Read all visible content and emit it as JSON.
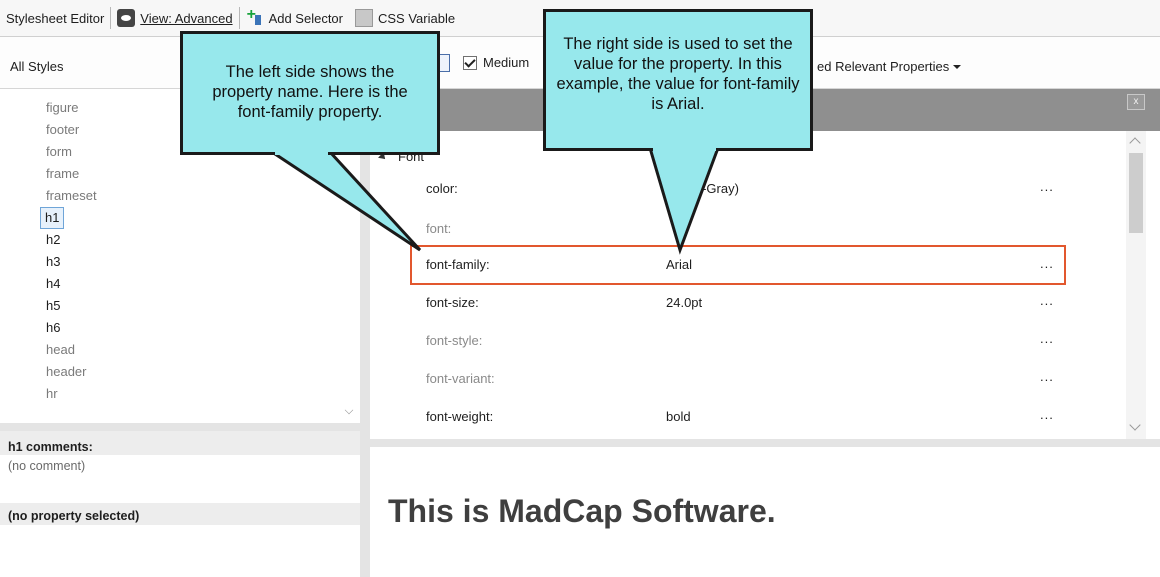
{
  "toolbar": {
    "title": "Stylesheet Editor",
    "view_label": "View: Advanced",
    "add_selector_label": "Add Selector",
    "css_variable_label": "CSS Variable"
  },
  "filterbar": {
    "all_styles_label": "All Styles",
    "medium_label": "Medium",
    "relevant_label": "ed Relevant Properties"
  },
  "selectors": [
    {
      "label": "figure",
      "state": "normal"
    },
    {
      "label": "footer",
      "state": "normal"
    },
    {
      "label": "form",
      "state": "normal"
    },
    {
      "label": "frame",
      "state": "normal"
    },
    {
      "label": "frameset",
      "state": "normal"
    },
    {
      "label": "h1",
      "state": "selected"
    },
    {
      "label": "h2",
      "state": "strong"
    },
    {
      "label": "h3",
      "state": "strong"
    },
    {
      "label": "h4",
      "state": "strong"
    },
    {
      "label": "h5",
      "state": "strong"
    },
    {
      "label": "h6",
      "state": "strong"
    },
    {
      "label": "head",
      "state": "normal"
    },
    {
      "label": "header",
      "state": "normal"
    },
    {
      "label": "hr",
      "state": "normal"
    }
  ],
  "comments": {
    "heading": "h1 comments:",
    "body": "(no comment)"
  },
  "property_panel": {
    "no_selection": "(no property selected)",
    "close_label": "x",
    "group_label": "Font",
    "properties": [
      {
        "name": "color:",
        "value": "--Dark-Gray)",
        "active": true,
        "more": "..."
      },
      {
        "name": "font:",
        "value": "",
        "active": false,
        "more": ""
      },
      {
        "name": "font-family:",
        "value": "Arial",
        "active": true,
        "more": "...",
        "highlight": true
      },
      {
        "name": "font-size:",
        "value": "24.0pt",
        "active": true,
        "more": "..."
      },
      {
        "name": "font-style:",
        "value": "",
        "active": false,
        "more": "..."
      },
      {
        "name": "font-variant:",
        "value": "",
        "active": false,
        "more": "..."
      },
      {
        "name": "font-weight:",
        "value": "bold",
        "active": true,
        "more": "..."
      }
    ]
  },
  "preview": {
    "heading": "This is MadCap Software."
  },
  "callouts": {
    "left": "The left side shows the property name. Here is the font-family property.",
    "right": "The right side is used to set the value for the property. In this example, the value for font-family is Arial."
  },
  "colors": {
    "callout_fill": "#97e8ec",
    "highlight_border": "#e2572e",
    "panel_header": "#8f8f8f"
  }
}
